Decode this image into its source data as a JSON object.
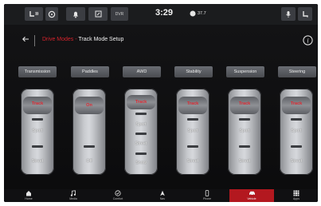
{
  "status_bar": {
    "clock": "3:29",
    "temperature": "37.7",
    "media_label": "DVR"
  },
  "header": {
    "back_icon": "back-arrow-icon",
    "breadcrumb_parent": "Drive Modes",
    "breadcrumb_separator": " - ",
    "breadcrumb_current": "Track Mode Setup",
    "info_icon": "info-icon"
  },
  "tabs": [
    {
      "label": "Transmission"
    },
    {
      "label": "Paddles"
    },
    {
      "label": "AWD"
    },
    {
      "label": "Stability"
    },
    {
      "label": "Suspension"
    },
    {
      "label": "Steering"
    }
  ],
  "selectors": [
    {
      "name": "transmission",
      "options": [
        "Track",
        "Sport",
        "Street"
      ],
      "selected": "Track"
    },
    {
      "name": "paddles",
      "options": [
        "On",
        "Off"
      ],
      "selected": "On"
    },
    {
      "name": "awd",
      "options": [
        "Track",
        "Sport",
        "Street",
        "Snow"
      ],
      "selected": "Track"
    },
    {
      "name": "stability",
      "options": [
        "Track",
        "Sport",
        "Street"
      ],
      "selected": "Track"
    },
    {
      "name": "suspension",
      "options": [
        "Track",
        "Sport",
        "Street"
      ],
      "selected": "Track"
    },
    {
      "name": "steering",
      "options": [
        "Track",
        "Sport",
        "Street"
      ],
      "selected": "Track"
    }
  ],
  "nav": [
    {
      "label": "Home",
      "icon": "home-icon"
    },
    {
      "label": "Media",
      "icon": "music-note-icon"
    },
    {
      "label": "Comfort",
      "icon": "comfort-icon"
    },
    {
      "label": "Nav",
      "icon": "navigation-arrow-icon"
    },
    {
      "label": "Phone",
      "icon": "phone-icon"
    },
    {
      "label": "Vehicle",
      "icon": "vehicle-icon",
      "active": true
    },
    {
      "label": "Apps",
      "icon": "apps-grid-icon"
    }
  ],
  "colors": {
    "accent_red": "#d3232b",
    "background": "#101012",
    "tab_gray": "#5a5c61"
  }
}
